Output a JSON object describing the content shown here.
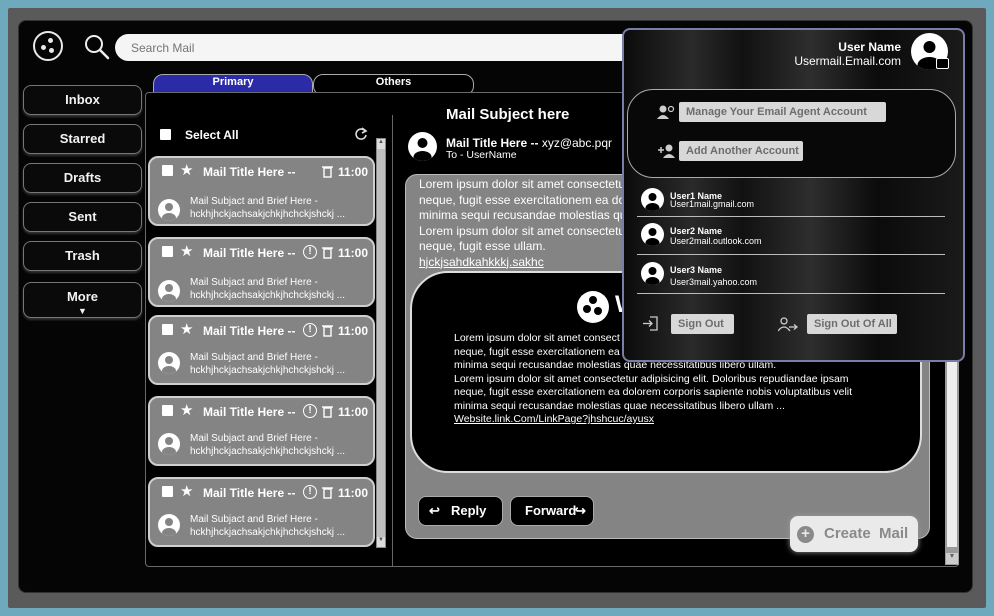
{
  "search": {
    "placeholder": "Search Mail"
  },
  "nav": [
    {
      "label": "Inbox"
    },
    {
      "label": "Starred"
    },
    {
      "label": "Drafts"
    },
    {
      "label": "Sent"
    },
    {
      "label": "Trash"
    },
    {
      "label": "More"
    }
  ],
  "tabs": [
    {
      "label": "Primary"
    },
    {
      "label": "Others"
    }
  ],
  "list": {
    "select_all_label": "Select All",
    "items": [
      {
        "title": "Mail Title Here --",
        "time": "11:00",
        "brief_line1": "Mail Subjact and Brief Here -",
        "brief_line2": "hckhjhckjachsakjchkjhchckjshckj ..."
      },
      {
        "title": "Mail Title Here --",
        "time": "11:00",
        "brief_line1": "Mail Subjact and Brief Here -",
        "brief_line2": "hckhjhckjachsakjchkjhchckjshckj ..."
      },
      {
        "title": "Mail Title Here --",
        "time": "11:00",
        "brief_line1": "Mail Subjact and Brief Here -",
        "brief_line2": "hckhjhckjachsakjchkjhchckjshckj ..."
      },
      {
        "title": "Mail Title Here --",
        "time": "11:00",
        "brief_line1": "Mail Subjact and Brief Here -",
        "brief_line2": "hckhjhckjachsakjchkjhchckjshckj ..."
      },
      {
        "title": "Mail Title Here --",
        "time": "11:00",
        "brief_line1": "Mail Subjact and Brief Here -",
        "brief_line2": "hckhjhckjachsakjchkjhchckjshckj ..."
      }
    ]
  },
  "message": {
    "subject": "Mail Subject here",
    "title": "Mail Title Here --",
    "from": "xyz@abc.pqr",
    "to": "To - UserName",
    "body_lines": [
      "Lorem ipsum dolor sit amet consectetu",
      "neque, fugit esse exercitationem ea do",
      "minima sequi recusandae molestias qu",
      "Lorem ipsum dolor sit amet consectetu",
      "neque, fugit esse ullam."
    ],
    "link": "hjckjsahdkahkkkj.sakhc",
    "inner_initial": "W",
    "inner_lines": [
      "Lorem ipsum dolor sit amet consect",
      "neque, fugit esse exercitationem ea",
      "minima sequi recusandae molestias quae necessitatibus libero ullam.",
      "Lorem ipsum dolor sit amet consectetur adipisicing elit. Doloribus repudiandae ipsam",
      "neque, fugit esse exercitationem ea dolorem corporis sapiente nobis voluptatibus velit",
      "minima sequi recusandae molestias quae necessitatibus libero ullam ..."
    ],
    "inner_link": "Website.link.Com/LinkPage?jhshcuc/ayusx",
    "reply_label": "Reply",
    "forward_label": "Forward"
  },
  "create_mail": {
    "label": "Create  Mail"
  },
  "account": {
    "name": "User Name",
    "email": "Usermail.Email.com",
    "manage_label": "Manage Your Email Agent Account",
    "add_label": "Add Another Account",
    "users": [
      {
        "name": "User1 Name",
        "email": "User1mail.gmail.com"
      },
      {
        "name": "User2 Name",
        "email": "User2mail.outlook.com"
      },
      {
        "name": "User3 Name",
        "email": "User3mail.yahoo.com"
      }
    ],
    "sign_out_label": "Sign Out",
    "sign_out_all_label": "Sign Out Of All"
  }
}
